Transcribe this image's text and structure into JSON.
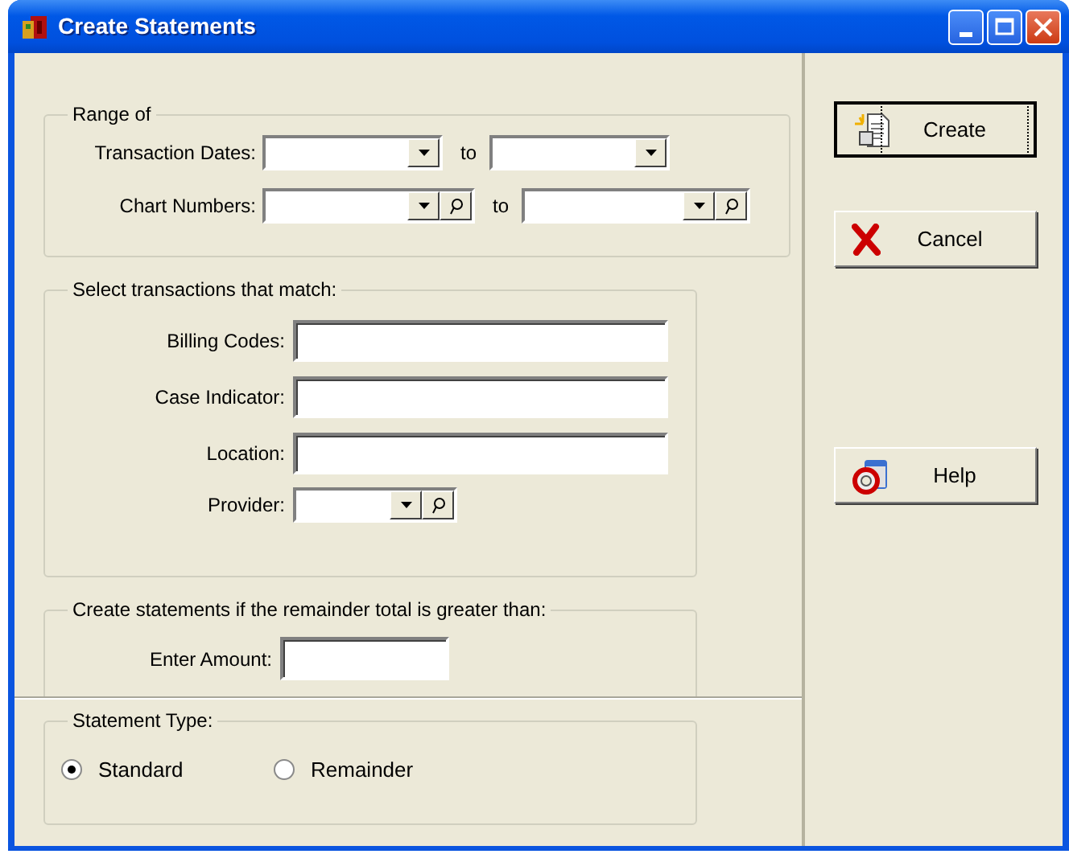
{
  "window": {
    "title": "Create Statements"
  },
  "range": {
    "title": "Range of",
    "rows": [
      {
        "label": "Transaction Dates:",
        "kind": "dropdown",
        "separator": "to"
      },
      {
        "label": "Chart Numbers:",
        "kind": "lookup",
        "separator": "to"
      }
    ]
  },
  "match": {
    "title": "Select transactions that match:",
    "fields": [
      {
        "label": "Billing Codes:",
        "kind": "text"
      },
      {
        "label": "Case  Indicator:",
        "kind": "text"
      },
      {
        "label": "Location:",
        "kind": "text"
      },
      {
        "label": "Provider:",
        "kind": "lookup"
      }
    ]
  },
  "remainder": {
    "title": "Create statements if the remainder total is greater than:",
    "field": {
      "label": "Enter Amount:"
    }
  },
  "statement_type": {
    "title": "Statement Type:",
    "options": [
      {
        "label": "Standard",
        "selected": true
      },
      {
        "label": "Remainder",
        "selected": false
      }
    ]
  },
  "buttons": [
    {
      "label": "Create",
      "kind": "create",
      "default": true
    },
    {
      "label": "Cancel",
      "kind": "cancel",
      "default": false
    },
    {
      "label": "Help",
      "kind": "help",
      "default": false
    }
  ]
}
